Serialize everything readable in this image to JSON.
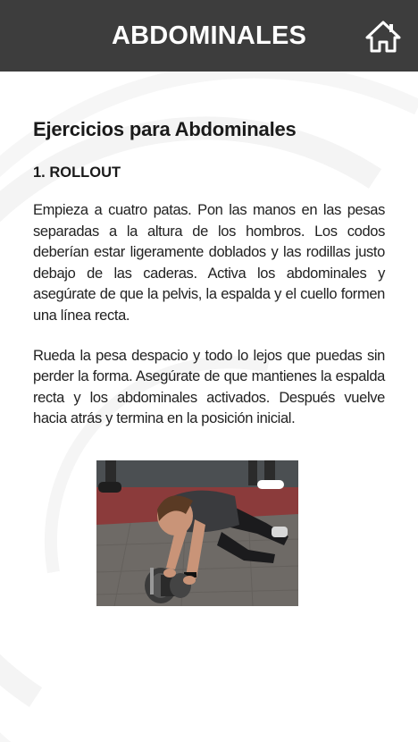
{
  "header": {
    "title": "ABDOMINALES",
    "home_icon": "home-icon",
    "background_color": "#3d3d3d"
  },
  "main": {
    "section_title": "Ejercicios para Abdominales",
    "exercise": {
      "title": "1. ROLLOUT",
      "paragraphs": [
        "Empieza a cuatro patas. Pon las manos en las pesas separadas a la altura de los hombros. Los codos deberían estar ligeramente doblados y las rodillas justo debajo de las caderas. Activa los abdominales y asegúrate de que la pelvis, la espalda y el cuello formen una línea recta.",
        "Rueda la pesa despacio y todo lo lejos que puedas sin perder la forma. Asegúrate de que mantienes la espalda recta y los abdominales activados. Después vuelve hacia atrás y termina en la posición inicial."
      ],
      "image_subject": "person-performing-ab-wheel-rollout"
    }
  }
}
